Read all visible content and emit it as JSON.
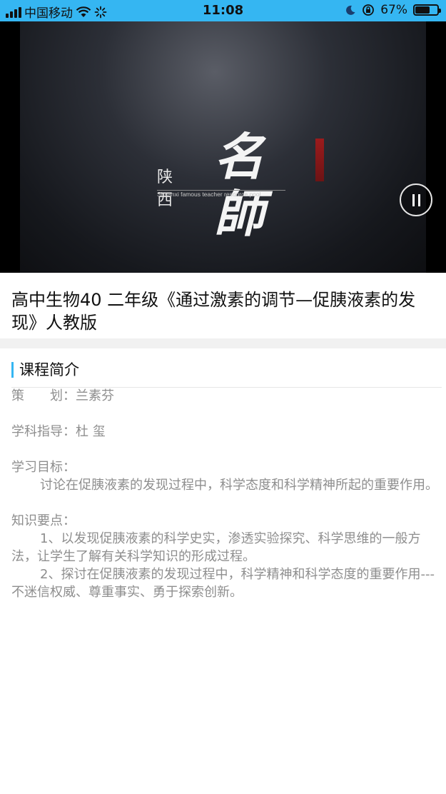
{
  "status_bar": {
    "carrier": "中国移动",
    "time": "11:08",
    "battery": "67%",
    "battery_level": 0.67
  },
  "video": {
    "logo_province": "陕西",
    "logo_brand": "名師",
    "logo_subtitle": "Shaanxi famous teacher resource pool",
    "pause_icon": "pause-icon"
  },
  "course": {
    "title": "高中生物40 二年级《通过激素的调节—促胰液素的发现》人教版"
  },
  "intro": {
    "heading": "课程简介",
    "planner": "策　　划：兰素芬",
    "guidance": "学科指导：杜  玺",
    "objective_label": "学习目标：",
    "objective_text": "讨论在促胰液素的发现过程中，科学态度和科学精神所起的重要作用。",
    "points_label": "知识要点：",
    "point_1": "1、以发现促胰液素的科学史实，渗透实验探究、科学思维的一般方法，让学生了解有关科学知识的形成过程。",
    "point_2": "2、探讨在促胰液素的发现过程中，科学精神和科学态度的重要作用---不迷信权威、尊重事实、勇于探索创新。"
  }
}
